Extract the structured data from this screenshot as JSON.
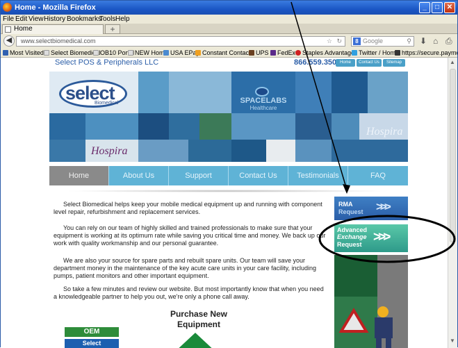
{
  "window": {
    "title": "Home - Mozilla Firefox",
    "minimize": "_",
    "maximize": "□",
    "close": "✕"
  },
  "menu": [
    "File",
    "Edit",
    "View",
    "History",
    "Bookmarks",
    "Tools",
    "Help"
  ],
  "tabs": [
    {
      "label": "Home"
    }
  ],
  "newtab": "+",
  "nav": {
    "url": "www.selectbiomedical.com",
    "search_placeholder": "Google"
  },
  "bookmarks": [
    {
      "label": "Most Visited",
      "color": "#3060b0"
    },
    {
      "label": "Select Biomedical",
      "color": "#dddddd"
    },
    {
      "label": "OB10 Portal",
      "color": "#dddddd"
    },
    {
      "label": "NEW Home",
      "color": "#dddddd"
    },
    {
      "label": "USA EPay",
      "color": "#4a8ad0"
    },
    {
      "label": "Constant Contact",
      "color": "#f0a020"
    },
    {
      "label": "UPS",
      "color": "#6a4020"
    },
    {
      "label": "FedEx",
      "color": "#5a2a8a"
    },
    {
      "label": "Staples Advantage",
      "color": "#d02020"
    },
    {
      "label": "Twitter / Home",
      "color": "#30a0e0"
    },
    {
      "label": "https://secure.paymo...",
      "color": "#333333"
    }
  ],
  "site": {
    "brand": "Select POS & Peripherals LLC",
    "phone": "866.559.3500",
    "top_links": [
      "Home",
      "Contact Us",
      "Sitemap"
    ],
    "logo_main": "select",
    "logo_sub": "Biomedical",
    "spacelabs": "SPACELABS",
    "spacelabs_sub": "Healthcare",
    "hospira": "Hospira",
    "menu": [
      "Home",
      "About Us",
      "Support",
      "Contact Us",
      "Testimonials",
      "FAQ"
    ],
    "paragraphs": [
      "Select Biomedical helps keep your mobile medical equipment up and running with component level repair, refurbishment and replacement services.",
      "You can rely on our team of highly skilled and trained professionals to make sure that your equipment is working at its optimum rate while saving you critical time and money. We back up our work with quality workmanship and our personal guarantee.",
      "We are also your source for spare parts and rebuilt spare units. Our team will save your department money in the maintenance of the key acute care units in your care facility, including pumps, patient monitors and other important equipment.",
      "So take a few minutes and review our website. But most importantly know that when you need a knowledgeable partner to help you out, we're only a phone call away."
    ],
    "rma_line1": "RMA",
    "rma_line2": "Request",
    "adv_line1": "Advanced",
    "adv_line2": "Exchange",
    "adv_line3": "Request",
    "purchase": "Purchase New Equipment",
    "oem": "OEM",
    "oem_select": "Select"
  }
}
